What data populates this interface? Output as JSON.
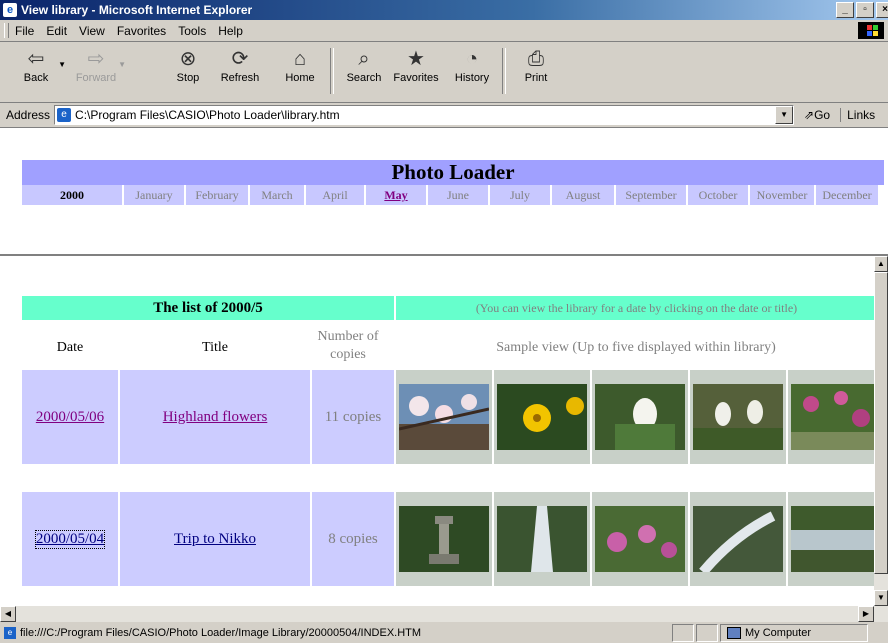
{
  "window": {
    "title": "View library - Microsoft Internet Explorer"
  },
  "menu": {
    "items": [
      "File",
      "Edit",
      "View",
      "Favorites",
      "Tools",
      "Help"
    ]
  },
  "toolbar": {
    "back": "Back",
    "forward": "Forward",
    "stop": "Stop",
    "refresh": "Refresh",
    "home": "Home",
    "search": "Search",
    "favorites": "Favorites",
    "history": "History",
    "print": "Print"
  },
  "address": {
    "label": "Address",
    "url": "C:\\Program Files\\CASIO\\Photo Loader\\library.htm",
    "go": "Go",
    "links": "Links"
  },
  "header": {
    "title": "Photo Loader",
    "year": "2000",
    "months": [
      "January",
      "February",
      "March",
      "April",
      "May",
      "June",
      "July",
      "August",
      "September",
      "October",
      "November",
      "December"
    ],
    "current_month": "May"
  },
  "library": {
    "list_title": "The list of 2000/5",
    "hint": "(You can view the library for a date by clicking on the date or title)",
    "col_date": "Date",
    "col_title": "Title",
    "col_copies": "Number of copies",
    "col_sample": "Sample view (Up to five displayed within library)",
    "rows": [
      {
        "date": "2000/05/06",
        "title": "Highland flowers",
        "copies": "11 copies"
      },
      {
        "date": "2000/05/04",
        "title": "Trip to Nikko",
        "copies": "8 copies"
      }
    ]
  },
  "status": {
    "url": "file:///C:/Program Files/CASIO/Photo Loader/Image Library/20000504/INDEX.HTM",
    "zone": "My Computer"
  },
  "colors": {
    "banner": "#a0a0ff",
    "month_bg": "#c8c8ff",
    "list_header": "#66ffcc",
    "row_bg": "#ccccff",
    "link": "#800080"
  }
}
